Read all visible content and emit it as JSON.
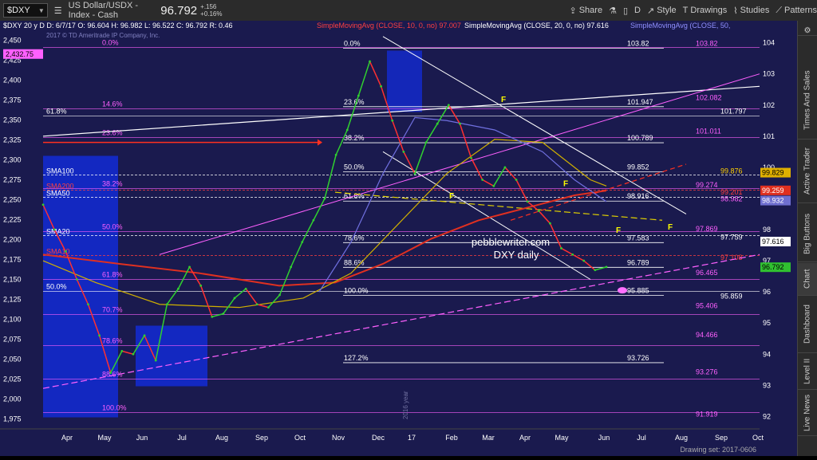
{
  "toolbar": {
    "symbol": "$DXY",
    "description": "US Dollar/USDX - Index - Cash",
    "last": "96.792",
    "change": "+.156",
    "change_pct": "+0.16%",
    "share": "Share",
    "interval": "D",
    "style": "Style",
    "drawings": "Drawings",
    "studies": "Studies",
    "patterns": "Patterns"
  },
  "sidebar": [
    "Times And Sales",
    "Active Trader",
    "Big Buttons",
    "Chart",
    "Dashboard",
    "Level II",
    "Live News"
  ],
  "chart_data": {
    "type": "line",
    "header": "$DXY 20 y D  D: 6/7/17  O: 96.604  H: 96.982  L: 96.522  C: 96.792  R: 0.46",
    "sma10_label": "SimpleMovingAvg (CLOSE, 10, 0, no)",
    "sma10_value": "97.007",
    "sma20_label": "SimpleMovingAvg (CLOSE, 20, 0, no)",
    "sma20_value": "97.616",
    "sma50_label": "SimpleMovingAvg (CLOSE, 50,",
    "copyright": "2017 © TD Ameritrade IP Company, Inc.",
    "watermark1": "pebblewriter.com",
    "watermark2": "DXY daily",
    "year_marker": "2016 year",
    "footer": "Drawing set: 2017-0606",
    "x_ticks": [
      "Apr",
      "May",
      "Jun",
      "Jul",
      "Aug",
      "Sep",
      "Oct",
      "Nov",
      "Dec",
      "17",
      "Feb",
      "Mar",
      "Apr",
      "May",
      "Jun",
      "Jul",
      "Aug",
      "Sep",
      "Oct"
    ],
    "left_axis": {
      "ylim": [
        1962.5,
        2462.5
      ],
      "ticks": [
        "2,450",
        "2,425",
        "2,400",
        "2,375",
        "2,350",
        "2,325",
        "2,300",
        "2,275",
        "2,250",
        "2,225",
        "2,200",
        "2,175",
        "2,150",
        "2,125",
        "2,100",
        "2,075",
        "2,050",
        "2,025",
        "2,000",
        "1,975"
      ],
      "last_label": "2,432.75"
    },
    "right_axis": {
      "ylim": [
        91.6,
        104.4
      ],
      "ticks": [
        "104",
        "103",
        "102",
        "101",
        "100",
        "99",
        "98",
        "97",
        "96",
        "95",
        "94",
        "93",
        "92"
      ]
    },
    "right_badges": [
      {
        "value": 99.829,
        "label": "99.829",
        "color": "#e0b000",
        "text_color": "#000"
      },
      {
        "value": 99.259,
        "label": "99.259",
        "color": "#e03020",
        "text_color": "#fff"
      },
      {
        "value": 98.932,
        "label": "98.932",
        "color": "#6f6fd0",
        "text_color": "#fff"
      },
      {
        "value": 97.616,
        "label": "97.616",
        "color": "#ffffff",
        "text_color": "#000"
      },
      {
        "value": 96.792,
        "label": "96.792",
        "color": "#30c030",
        "text_color": "#000"
      }
    ],
    "ma_labels": [
      {
        "text": "SMA100",
        "value": 2281,
        "color": "#ffffff"
      },
      {
        "text": "SMA200",
        "value": 2262,
        "color": "#ff4040"
      },
      {
        "text": "SMA50",
        "value": 2253,
        "color": "#ffffff"
      },
      {
        "text": "SMA20",
        "value": 2205,
        "color": "#ffffff"
      },
      {
        "text": "SMA10",
        "value": 2180,
        "color": "#ff4040"
      }
    ],
    "fib_left": [
      {
        "pct": "0.0%",
        "value": 2441,
        "color": "#ff60ff"
      },
      {
        "pct": "14.6%",
        "value": 2364,
        "color": "#ff60ff"
      },
      {
        "pct": "23.6%",
        "value": 2328,
        "color": "#ff60ff"
      },
      {
        "pct": "38.2%",
        "value": 2264,
        "color": "#ff60ff"
      },
      {
        "pct": "50.0%",
        "value": 2210,
        "color": "#ff60ff"
      },
      {
        "pct": "61.8%",
        "value": 2150,
        "color": "#ff60ff"
      },
      {
        "pct": "70.7%",
        "value": 2106,
        "color": "#ff60ff"
      },
      {
        "pct": "78.6%",
        "value": 2067,
        "color": "#ff60ff"
      },
      {
        "pct": "88.6%",
        "value": 2025,
        "color": "#ff60ff"
      },
      {
        "pct": "100.0%",
        "value": 1983,
        "color": "#ff60ff"
      },
      {
        "pct": "61.8%",
        "value": 2355,
        "color": "#ffffff"
      },
      {
        "pct": "50.0%",
        "value": 2135,
        "color": "#ffffff"
      }
    ],
    "fib_mid": [
      {
        "pct": "0.0%",
        "value": 103.82
      },
      {
        "pct": "23.6%",
        "value": 101.947
      },
      {
        "pct": "38.2%",
        "value": 100.789
      },
      {
        "pct": "50.0%",
        "value": 99.852
      },
      {
        "pct": "61.8%",
        "value": 98.916
      },
      {
        "pct": "78.6%",
        "value": 97.583
      },
      {
        "pct": "88.6%",
        "value": 96.789
      },
      {
        "pct": "100.0%",
        "value": 95.885
      },
      {
        "pct": "127.2%",
        "value": 93.726
      }
    ],
    "fib_right_magenta": [
      {
        "label": "103.82",
        "value": 103.82
      },
      {
        "label": "102.082",
        "value": 102.082
      },
      {
        "label": "101.011",
        "value": 101.011
      },
      {
        "label": "99.274",
        "value": 99.274
      },
      {
        "label": "97.869",
        "value": 97.869
      },
      {
        "label": "96.465",
        "value": 96.465
      },
      {
        "label": "95.406",
        "value": 95.406
      },
      {
        "label": "94.466",
        "value": 94.466
      },
      {
        "label": "93.276",
        "value": 93.276
      },
      {
        "label": "91.919",
        "value": 91.919
      }
    ],
    "fib_right_white": [
      {
        "label": "101.797",
        "value": 101.797
      },
      {
        "label": "99.876",
        "value": 99.876,
        "color": "#ffd000"
      },
      {
        "label": "99.201",
        "value": 99.201,
        "color": "#ff4040"
      },
      {
        "label": "98.982",
        "value": 98.982,
        "color": "#ff60ff"
      },
      {
        "label": "97.759",
        "value": 97.759
      },
      {
        "label": "97.108",
        "value": 97.108,
        "color": "#ff4040"
      },
      {
        "label": "95.859",
        "value": 95.859
      }
    ],
    "price_series": [
      {
        "x": 0.0,
        "y": 98.8
      },
      {
        "x": 0.02,
        "y": 98.0
      },
      {
        "x": 0.04,
        "y": 97.3
      },
      {
        "x": 0.06,
        "y": 96.4
      },
      {
        "x": 0.08,
        "y": 95.6
      },
      {
        "x": 0.1,
        "y": 94.6
      },
      {
        "x": 0.12,
        "y": 93.4
      },
      {
        "x": 0.14,
        "y": 94.1
      },
      {
        "x": 0.16,
        "y": 94.0
      },
      {
        "x": 0.18,
        "y": 94.6
      },
      {
        "x": 0.2,
        "y": 93.8
      },
      {
        "x": 0.22,
        "y": 95.6
      },
      {
        "x": 0.24,
        "y": 96.1
      },
      {
        "x": 0.26,
        "y": 96.8
      },
      {
        "x": 0.28,
        "y": 96.2
      },
      {
        "x": 0.3,
        "y": 95.2
      },
      {
        "x": 0.32,
        "y": 95.3
      },
      {
        "x": 0.34,
        "y": 95.8
      },
      {
        "x": 0.36,
        "y": 96.1
      },
      {
        "x": 0.38,
        "y": 95.6
      },
      {
        "x": 0.4,
        "y": 95.5
      },
      {
        "x": 0.42,
        "y": 95.9
      },
      {
        "x": 0.44,
        "y": 96.8
      },
      {
        "x": 0.46,
        "y": 97.6
      },
      {
        "x": 0.48,
        "y": 98.3
      },
      {
        "x": 0.5,
        "y": 99.0
      },
      {
        "x": 0.52,
        "y": 100.4
      },
      {
        "x": 0.54,
        "y": 101.2
      },
      {
        "x": 0.56,
        "y": 102.3
      },
      {
        "x": 0.58,
        "y": 103.4
      },
      {
        "x": 0.6,
        "y": 102.6
      },
      {
        "x": 0.62,
        "y": 101.5
      },
      {
        "x": 0.64,
        "y": 100.5
      },
      {
        "x": 0.66,
        "y": 99.8
      },
      {
        "x": 0.68,
        "y": 100.8
      },
      {
        "x": 0.7,
        "y": 101.4
      },
      {
        "x": 0.72,
        "y": 102.0
      },
      {
        "x": 0.74,
        "y": 101.4
      },
      {
        "x": 0.76,
        "y": 100.3
      },
      {
        "x": 0.78,
        "y": 99.6
      },
      {
        "x": 0.8,
        "y": 99.4
      },
      {
        "x": 0.82,
        "y": 100.0
      },
      {
        "x": 0.84,
        "y": 99.6
      },
      {
        "x": 0.86,
        "y": 98.9
      },
      {
        "x": 0.88,
        "y": 98.6
      },
      {
        "x": 0.9,
        "y": 98.2
      },
      {
        "x": 0.92,
        "y": 97.4
      },
      {
        "x": 0.94,
        "y": 97.2
      },
      {
        "x": 0.96,
        "y": 97.0
      },
      {
        "x": 0.98,
        "y": 96.7
      },
      {
        "x": 1.0,
        "y": 96.8
      }
    ]
  }
}
